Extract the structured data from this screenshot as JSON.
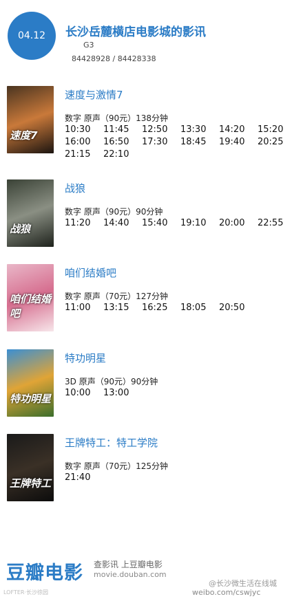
{
  "header": {
    "date": "04.12",
    "cinema_name": "长沙岳麓横店电影城的影讯",
    "address": "G3",
    "phone": "84428928 / 84428338"
  },
  "movies": [
    {
      "title": "速度与激情7",
      "meta": "数字  原声（90元）138分钟",
      "poster_text": "速度7",
      "poster_colors": [
        "#4a3420",
        "#c9793a",
        "#1b1410"
      ],
      "times": [
        "10:30",
        "11:45",
        "12:50",
        "13:30",
        "14:20",
        "15:20",
        "16:00",
        "16:50",
        "17:30",
        "18:45",
        "19:40",
        "20:25",
        "21:15",
        "22:10"
      ]
    },
    {
      "title": "战狼",
      "meta": "数字  原声（90元）90分钟",
      "poster_text": "战狼",
      "poster_colors": [
        "#3a4236",
        "#8a8f83",
        "#1e221c"
      ],
      "times": [
        "11:20",
        "14:40",
        "15:40",
        "19:10",
        "20:00",
        "22:55"
      ]
    },
    {
      "title": "咱们结婚吧",
      "meta": "数字  原声（70元）127分钟",
      "poster_text": "咱们结婚吧",
      "poster_colors": [
        "#e9b7c8",
        "#d66e8f",
        "#f7e6ea"
      ],
      "times": [
        "11:00",
        "13:15",
        "16:25",
        "18:05",
        "20:50"
      ]
    },
    {
      "title": "特功明星",
      "meta": "3D  原声（90元）90分钟",
      "poster_text": "特功明星",
      "poster_colors": [
        "#3b8fd3",
        "#e0a436",
        "#3b6e2c"
      ],
      "times": [
        "10:00",
        "13:00"
      ]
    },
    {
      "title": "王牌特工：特工学院",
      "meta": "数字  原声（70元）125分钟",
      "poster_text": "王牌特工",
      "poster_colors": [
        "#1a1a1a",
        "#3a3026",
        "#0c0c0c"
      ],
      "times": [
        "21:40"
      ]
    }
  ],
  "footer": {
    "logo": "豆瓣电影",
    "slogan": "查影讯  上豆瓣电影",
    "url": "movie.douban.com",
    "watermark_left": "LOFTER·长沙徐园",
    "watermark_right_1": "@长沙微生活在线城",
    "watermark_right_2": "weibo.com/cswjyc"
  },
  "colors": {
    "accent": "#2b7cc6"
  }
}
